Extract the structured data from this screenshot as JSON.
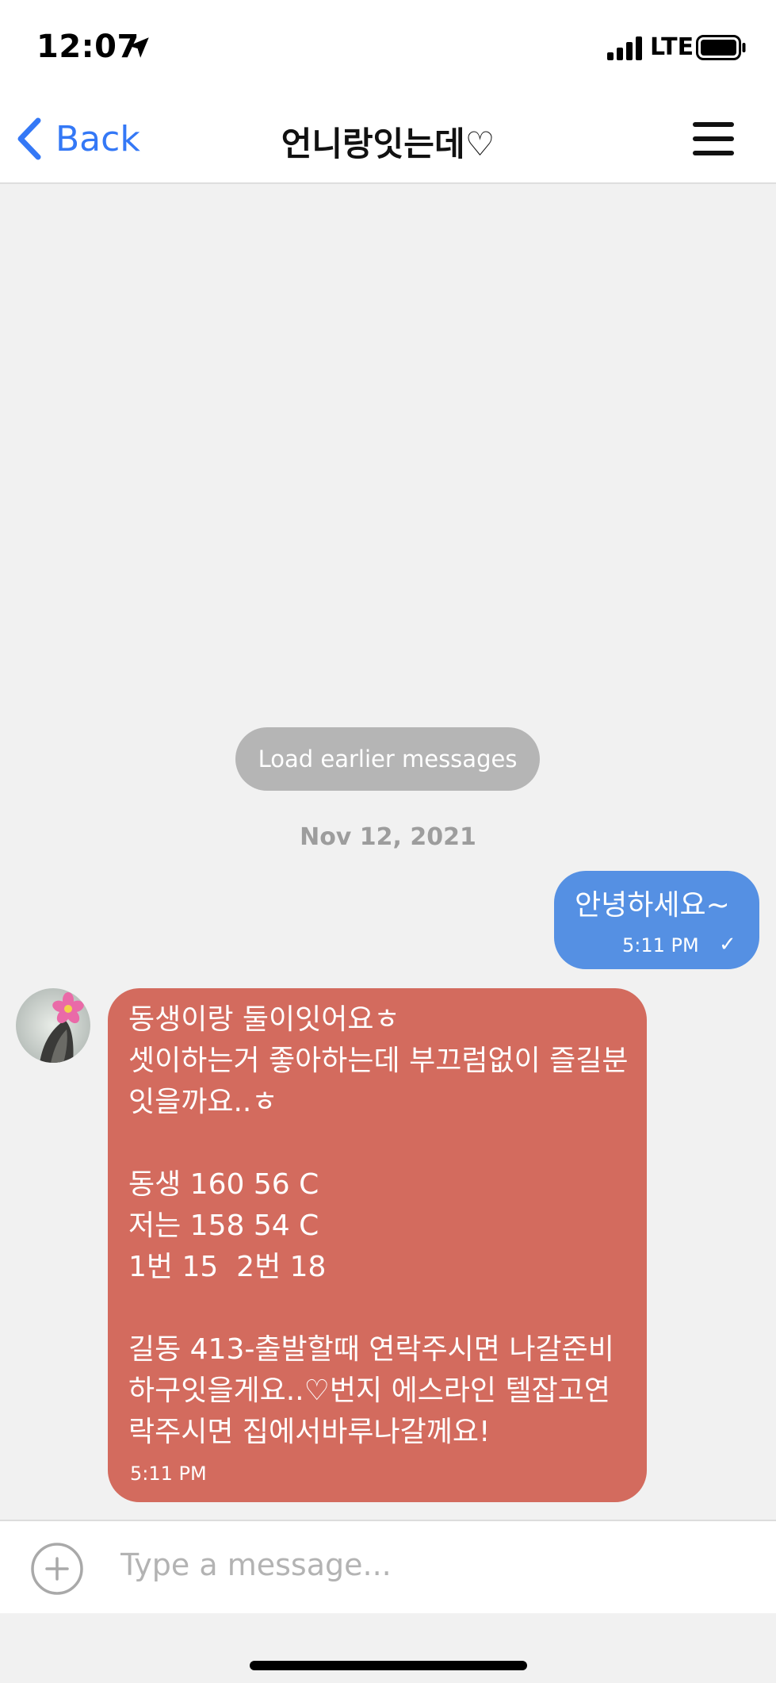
{
  "status_bar": {
    "time": "12:07",
    "network": "LTE",
    "icons": [
      "location-arrow-icon",
      "signal-bars-icon",
      "battery-icon"
    ]
  },
  "nav": {
    "back_label": "Back",
    "title": "언니랑잇는데♡",
    "icons": [
      "back-chevron-icon",
      "hamburger-menu-icon"
    ],
    "accent_color": "#3478f6"
  },
  "chat": {
    "load_earlier_label": "Load earlier messages",
    "date_separator": "Nov 12, 2021",
    "messages": [
      {
        "direction": "outgoing",
        "text": "안녕하세요~",
        "time": "5:11 PM",
        "status": "✓",
        "bubble_color": "#5590e3"
      },
      {
        "direction": "incoming",
        "text": "동생이랑 둘이잇어요ㅎ\n셋이하는거 좋아하는데 부끄럼없이 즐길분잇을까요..ㅎ\n\n동생 160 56 C\n저는 158 54 C\n1번 15  2번 18\n\n길동 413-출발할때 연락주시면 나갈준비하구잇을게요..♡번지 에스라인 텔잡고연락주시면 집에서바루나갈께요!",
        "time": "5:11 PM",
        "bubble_color": "#d36b5e"
      }
    ]
  },
  "composer": {
    "placeholder": "Type a message...",
    "value": "",
    "icons": [
      "add-circle-icon"
    ]
  }
}
